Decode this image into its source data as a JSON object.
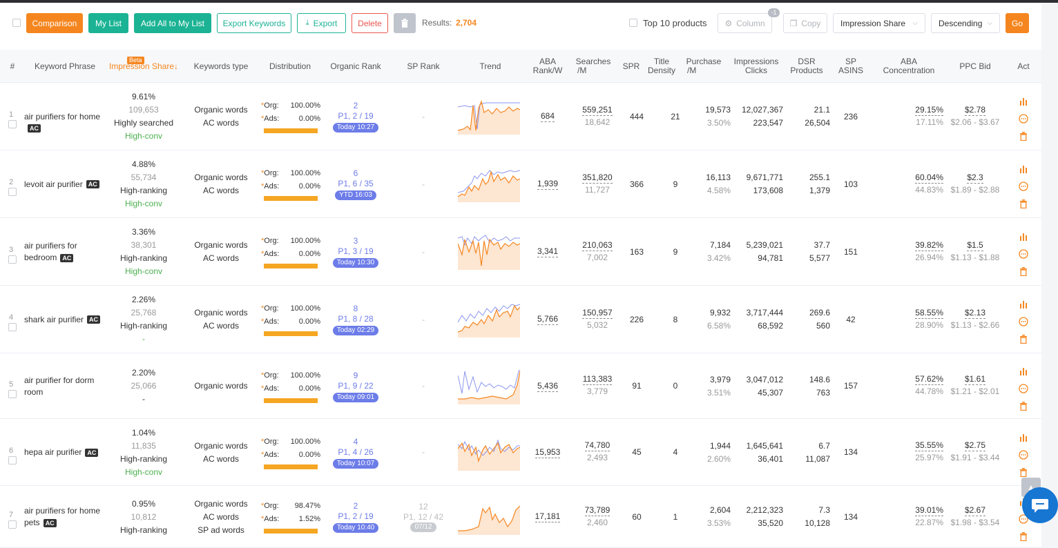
{
  "toolbar": {
    "comparison": "Comparison",
    "my_list": "My List",
    "add_all": "Add All to My List",
    "export_keywords": "Export Keywords",
    "export": "Export",
    "delete": "Delete",
    "results_label": "Results:",
    "results_count": "2,704",
    "top10_label": "Top 10 products",
    "column": "Column",
    "column_badge": "-1",
    "copy": "Copy",
    "sort_field": "Impression Share",
    "sort_order": "Descending",
    "go": "Go"
  },
  "colors": {
    "accent": "#f5861f",
    "teal": "#1bb394",
    "rank_blue": "#6c7ce8"
  },
  "headers": {
    "idx": "#",
    "keyword": "Keyword Phrase",
    "impression": "Impression Share↓",
    "impression_badge": "Beta",
    "kwtype": "Keywords type",
    "distribution": "Distribution",
    "organic_rank": "Organic Rank",
    "sp_rank": "SP Rank",
    "trend": "Trend",
    "aba_rank_1": "ABA",
    "aba_rank_2": "Rank/W",
    "searches_1": "Searches",
    "searches_2": "/M",
    "spr": "SPR",
    "title_density_1": "Title",
    "title_density_2": "Density",
    "purchase_1": "Purchase",
    "purchase_2": "/M",
    "impressions_1": "Impressions",
    "impressions_2": "Clicks",
    "dsr_1": "DSR",
    "dsr_2": "Products",
    "sp_asins_1": "SP",
    "sp_asins_2": "ASINS",
    "aba_conc_1": "ABA",
    "aba_conc_2": "Concentration",
    "ppc": "PPC Bid",
    "act": "Act"
  },
  "rows": [
    {
      "idx": "1",
      "kw": "air purifiers for home",
      "kw2": "",
      "ac": "AC",
      "imp": "9.61%",
      "imp_n": "109,653",
      "tag1": "Highly searched",
      "tag2": "High-conv",
      "types": [
        "Organic words",
        "AC words"
      ],
      "org": "100.00%",
      "ads": "0.00%",
      "rank": "2",
      "page": "P1, 2 / 19",
      "time": "Today 10:27",
      "sp": "-",
      "sp2": "",
      "sp3": "",
      "aba": "684",
      "searches": "559,251",
      "searches2": "18,642",
      "spr": "444",
      "td": "21",
      "pur": "19,573",
      "pur2": "3.50%",
      "impr": "12,027,367",
      "clicks": "223,547",
      "dsr": "21.1",
      "dsrp": "26,504",
      "spa": "236",
      "conc": "29.15%",
      "conc2": "17.11%",
      "ppc": "$2.78",
      "ppc2": "$2.06 - $3.67"
    },
    {
      "idx": "2",
      "kw": "levoit air purifier",
      "kw2": "",
      "ac": "AC",
      "imp": "4.88%",
      "imp_n": "55,734",
      "tag1": "High-ranking",
      "tag2": "High-conv",
      "types": [
        "Organic words",
        "AC words"
      ],
      "org": "100.00%",
      "ads": "0.00%",
      "rank": "6",
      "page": "P1, 6 / 35",
      "time": "YTD 16:03",
      "sp": "-",
      "sp2": "",
      "sp3": "",
      "aba": "1,939",
      "searches": "351,820",
      "searches2": "11,727",
      "spr": "366",
      "td": "9",
      "pur": "16,113",
      "pur2": "4.58%",
      "impr": "9,671,771",
      "clicks": "173,608",
      "dsr": "255.1",
      "dsrp": "1,379",
      "spa": "103",
      "conc": "60.04%",
      "conc2": "44.83%",
      "ppc": "$2.3",
      "ppc2": "$1.89 - $2.88"
    },
    {
      "idx": "3",
      "kw": "air purifiers for",
      "kw2": "bedroom",
      "ac": "AC",
      "imp": "3.36%",
      "imp_n": "38,301",
      "tag1": "High-ranking",
      "tag2": "High-conv",
      "types": [
        "Organic words",
        "AC words"
      ],
      "org": "100.00%",
      "ads": "0.00%",
      "rank": "3",
      "page": "P1, 3 / 19",
      "time": "Today 10:30",
      "sp": "-",
      "sp2": "",
      "sp3": "",
      "aba": "3,341",
      "searches": "210,063",
      "searches2": "7,002",
      "spr": "163",
      "td": "9",
      "pur": "7,184",
      "pur2": "3.42%",
      "impr": "5,239,021",
      "clicks": "94,781",
      "dsr": "37.7",
      "dsrp": "5,577",
      "spa": "151",
      "conc": "39.82%",
      "conc2": "26.94%",
      "ppc": "$1.5",
      "ppc2": "$1.13 - $1.88"
    },
    {
      "idx": "4",
      "kw": "shark air purifier",
      "kw2": "",
      "ac": "AC",
      "imp": "2.26%",
      "imp_n": "25,768",
      "tag1": "High-ranking",
      "tag2": "-",
      "types": [
        "Organic words",
        "AC words"
      ],
      "org": "100.00%",
      "ads": "0.00%",
      "rank": "8",
      "page": "P1, 8 / 28",
      "time": "Today 02:29",
      "sp": "-",
      "sp2": "",
      "sp3": "",
      "aba": "5,766",
      "searches": "150,957",
      "searches2": "5,032",
      "spr": "226",
      "td": "8",
      "pur": "9,932",
      "pur2": "6.58%",
      "impr": "3,717,444",
      "clicks": "68,592",
      "dsr": "269.6",
      "dsrp": "560",
      "spa": "42",
      "conc": "58.55%",
      "conc2": "28.90%",
      "ppc": "$2.13",
      "ppc2": "$1.13 - $2.66"
    },
    {
      "idx": "5",
      "kw": "air purifier for dorm",
      "kw2": "room",
      "ac": "",
      "imp": "2.20%",
      "imp_n": "25,066",
      "tag1": "-",
      "tag2": "",
      "types": [
        "Organic words"
      ],
      "org": "100.00%",
      "ads": "0.00%",
      "rank": "9",
      "page": "P1, 9 / 22",
      "time": "Today 09:01",
      "sp": "-",
      "sp2": "",
      "sp3": "",
      "aba": "5,436",
      "searches": "113,383",
      "searches2": "3,779",
      "spr": "91",
      "td": "0",
      "pur": "3,979",
      "pur2": "3.51%",
      "impr": "3,047,012",
      "clicks": "45,307",
      "dsr": "148.6",
      "dsrp": "763",
      "spa": "157",
      "conc": "57.62%",
      "conc2": "44.78%",
      "ppc": "$1.61",
      "ppc2": "$1.21 - $2.01"
    },
    {
      "idx": "6",
      "kw": "hepa air purifier",
      "kw2": "",
      "ac": "AC",
      "imp": "1.04%",
      "imp_n": "11,835",
      "tag1": "High-ranking",
      "tag2": "High-conv",
      "types": [
        "Organic words",
        "AC words"
      ],
      "org": "100.00%",
      "ads": "0.00%",
      "rank": "4",
      "page": "P1, 4 / 26",
      "time": "Today 10:07",
      "sp": "-",
      "sp2": "",
      "sp3": "",
      "aba": "15,953",
      "searches": "74,780",
      "searches2": "2,493",
      "spr": "45",
      "td": "4",
      "pur": "1,944",
      "pur2": "2.60%",
      "impr": "1,645,641",
      "clicks": "36,401",
      "dsr": "6.7",
      "dsrp": "11,087",
      "spa": "134",
      "conc": "35.55%",
      "conc2": "25.97%",
      "ppc": "$2.75",
      "ppc2": "$1.91 - $3.44"
    },
    {
      "idx": "7",
      "kw": "air purifiers for home",
      "kw2": "pets",
      "ac": "AC",
      "imp": "0.95%",
      "imp_n": "10,812",
      "tag1": "High-ranking",
      "tag2": "",
      "types": [
        "Organic words",
        "AC words",
        "SP ad words"
      ],
      "org": "98.47%",
      "ads": "1.52%",
      "rank": "2",
      "page": "P1, 2 / 19",
      "time": "Today 10:40",
      "sp": "12",
      "sp2": "P1, 12 / 42",
      "sp3": "07/12",
      "aba": "17,181",
      "searches": "73,789",
      "searches2": "2,460",
      "spr": "60",
      "td": "1",
      "pur": "2,604",
      "pur2": "3.53%",
      "impr": "2,212,323",
      "clicks": "35,520",
      "dsr": "7.3",
      "dsrp": "10,128",
      "spa": "134",
      "conc": "39.01%",
      "conc2": "22.87%",
      "ppc": "$2.67",
      "ppc2": "$1.98 - $3.54"
    }
  ]
}
